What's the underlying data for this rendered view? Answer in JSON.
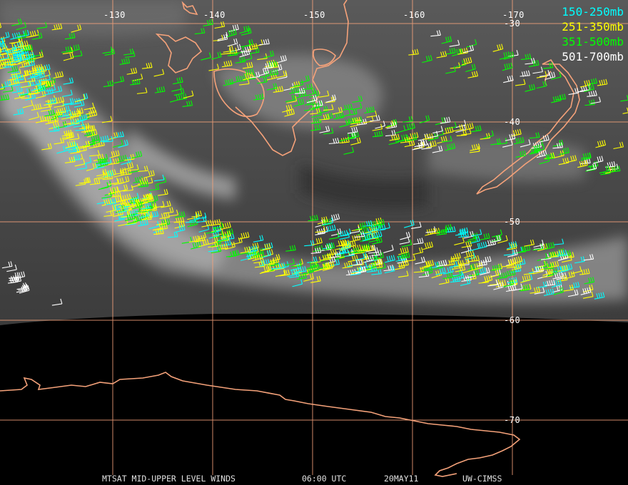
{
  "map": {
    "longitude_labels": [
      "-130",
      "-140",
      "-150",
      "-160",
      "-170"
    ],
    "latitude_labels": [
      "-30",
      "-40",
      "-50",
      "-60",
      "-70"
    ],
    "colors": {
      "grid": "#f5a27a",
      "coast": "#f5a27a",
      "night_area": "#000000"
    }
  },
  "legend": [
    {
      "label": "150-250mb",
      "color": "#00ffff"
    },
    {
      "label": "251-350mb",
      "color": "#ffff00"
    },
    {
      "label": "351-500mb",
      "color": "#00ff00"
    },
    {
      "label": "501-700mb",
      "color": "#ffffff"
    }
  ],
  "footer": {
    "product": "MTSAT MID-UPPER LEVEL WINDS",
    "time": "06:00 UTC",
    "date": "20MAY11",
    "source": "UW-CIMSS"
  }
}
